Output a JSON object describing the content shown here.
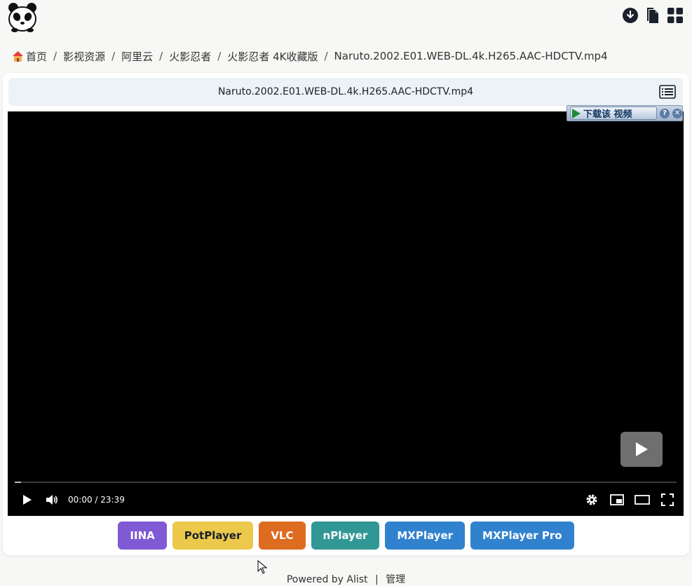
{
  "topbar": {
    "logo": "panda-logo",
    "actions": [
      "download-icon",
      "copy-icon",
      "grid-icon"
    ]
  },
  "breadcrumb": {
    "items": [
      "首页",
      "影视资源",
      "阿里云",
      "火影忍者",
      "火影忍者 4K收藏版",
      "Naruto.2002.E01.WEB-DL.4k.H265.AAC-HDCTV.mp4"
    ],
    "separator": "/"
  },
  "file": {
    "name": "Naruto.2002.E01.WEB-DL.4k.H265.AAC-HDCTV.mp4"
  },
  "downloader": {
    "label": "下载该 视频",
    "help": "?",
    "close": "✕"
  },
  "player": {
    "current_time": "00:00",
    "duration": "23:39",
    "time_text": "00:00 / 23:39",
    "progress": 0.01
  },
  "apps": [
    {
      "label": "IINA",
      "color": "#805ad5"
    },
    {
      "label": "PotPlayer",
      "color": "#ecc94b"
    },
    {
      "label": "VLC",
      "color": "#dd6b20"
    },
    {
      "label": "nPlayer",
      "color": "#319795"
    },
    {
      "label": "MXPlayer",
      "color": "#3182ce"
    },
    {
      "label": "MXPlayer Pro",
      "color": "#3182ce"
    }
  ],
  "footer": {
    "powered": "Powered by Alist",
    "divider": "|",
    "manage": "管理"
  }
}
